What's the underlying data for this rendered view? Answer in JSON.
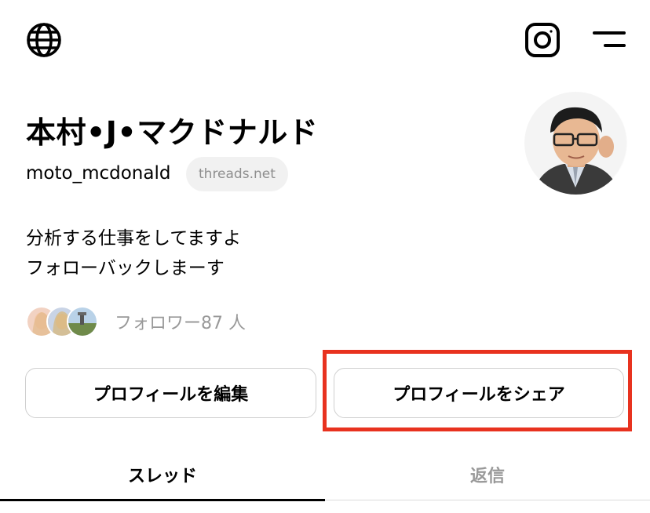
{
  "header": {
    "left_icon": "globe-icon",
    "right_icons": [
      "instagram-icon",
      "menu-icon"
    ]
  },
  "profile": {
    "display_name": "本村•J•マクドナルド",
    "username": "moto_mcdonald",
    "domain_badge": "threads.net",
    "bio_lines": [
      "分析する仕事をしてますよ",
      "フォローバックしまーす"
    ],
    "followers_text": "フォロワー87 人"
  },
  "buttons": {
    "edit_profile": "プロフィールを編集",
    "share_profile": "プロフィールをシェア"
  },
  "tabs": [
    {
      "label": "スレッド",
      "active": true
    },
    {
      "label": "返信",
      "active": false
    }
  ],
  "colors": {
    "highlight": "#e8321f",
    "text_primary": "#000000",
    "text_muted": "#999999",
    "badge_bg": "#f1f1f1"
  }
}
